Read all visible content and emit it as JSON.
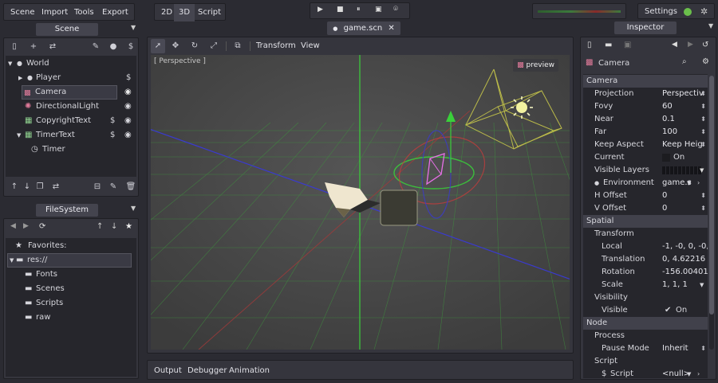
{
  "menu": {
    "scene": "Scene",
    "import": "Import",
    "tools": "Tools",
    "export": "Export"
  },
  "modes": {
    "d2": "2D",
    "d3": "3D",
    "script": "Script"
  },
  "topbar": {
    "settings": "Settings"
  },
  "scene_tab": {
    "title": "Scene"
  },
  "tree": {
    "world": "World",
    "player": "Player",
    "camera": "Camera",
    "light": "DirectionalLight",
    "copyright": "CopyrightText",
    "timertext": "TimerText",
    "timer": "Timer"
  },
  "fs": {
    "title": "FileSystem",
    "favorites": "Favorites:",
    "res": "res://",
    "fonts": "Fonts",
    "scenes": "Scenes",
    "scripts": "Scripts",
    "raw": "raw"
  },
  "editor": {
    "tab": "game.scn",
    "transform": "Transform",
    "view": "View",
    "perspective": "[ Perspective ]",
    "preview": "preview"
  },
  "bottom": {
    "output": "Output",
    "debugger": "Debugger",
    "animation": "Animation"
  },
  "inspector": {
    "title": "Inspector",
    "node_name": "Camera",
    "camera_section": "Camera",
    "projection_l": "Projection",
    "projection_v": "Perspectiv",
    "fovy_l": "Fovy",
    "fovy_v": "60",
    "near_l": "Near",
    "near_v": "0.1",
    "far_l": "Far",
    "far_v": "100",
    "keepaspect_l": "Keep Aspect",
    "keepaspect_v": "Keep Heig",
    "current_l": "Current",
    "current_v": "On",
    "visiblelayers_l": "Visible Layers",
    "environment_l": "Environment",
    "environment_v": "game.s",
    "hoffset_l": "H Offset",
    "hoffset_v": "0",
    "voffset_l": "V Offset",
    "voffset_v": "0",
    "spatial_section": "Spatial",
    "transform_l": "Transform",
    "local_l": "Local",
    "local_v": "-1, -0, 0, -0,",
    "translation_l": "Translation",
    "translation_v": "0, 4.62216",
    "rotation_l": "Rotation",
    "rotation_v": "-156.00401",
    "scale_l": "Scale",
    "scale_v": "1, 1, 1",
    "visibility_l": "Visibility",
    "visible_l": "Visible",
    "visible_v": "On",
    "node_section": "Node",
    "process_l": "Process",
    "pausemode_l": "Pause Mode",
    "pausemode_v": "Inherit",
    "script_l": "Script",
    "scriptprop_l": "Script",
    "scriptprop_v": "<null>"
  },
  "colors": {
    "accent": "#6a9fd4",
    "bg": "#2b2b32",
    "panel": "#35353d",
    "viewport": "#4a4a4a",
    "grid": "#3f8f3f"
  }
}
